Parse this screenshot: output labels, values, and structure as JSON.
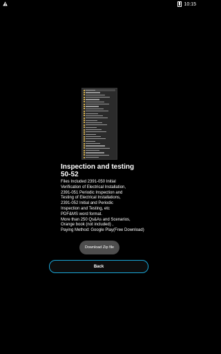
{
  "statusbar": {
    "time": "10:15"
  },
  "content": {
    "title": "Inspection and testing 50-52",
    "description_lines": [
      "Files Included 2391-050 Initial",
      "Verification of Electrical Installation,",
      "2391-051 Periodic Inspection and",
      "Testing of Electrical Installations,",
      "2391-052 Initial and Periodic",
      "Inspection and Testing, etc",
      "PDF&MS word format.",
      "More than 250 Qs&As and Scenarios,",
      "Orange book (not included) ,",
      "Paying Method: Google Play(Free Download)"
    ]
  },
  "buttons": {
    "download_label": "Download Zip file",
    "back_label": "Back"
  },
  "colors": {
    "background": "#000000",
    "accent_border": "#1aa7d8",
    "download_button": "#4d4d4d"
  }
}
